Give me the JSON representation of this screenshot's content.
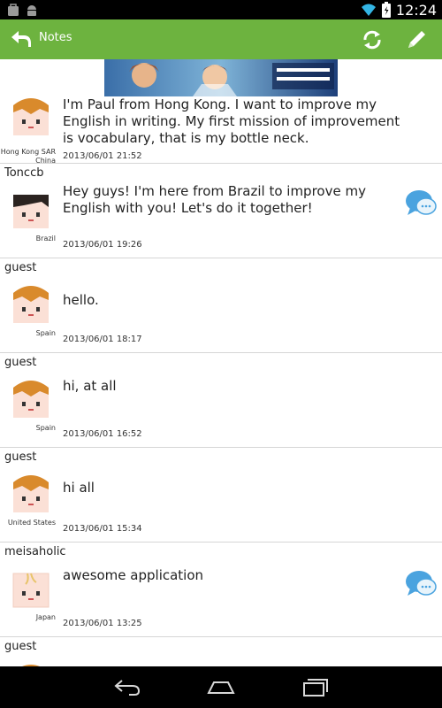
{
  "statusbar": {
    "time": "12:24"
  },
  "actionbar": {
    "title": "Notes"
  },
  "notes": [
    {
      "username": "",
      "country_line1": "Hong Kong SAR",
      "country_line2": "China",
      "message": "I'm Paul from Hong Kong. I want to improve my English in writing. My first mission of improvement is vocabulary, that is my bottle neck.",
      "timestamp": "2013/06/01 21:52",
      "avatar": "bread-icon"
    },
    {
      "username": "Tonccb",
      "country_line1": "Brazil",
      "country_line2": "",
      "message": "Hey guys! I'm here from Brazil to improve my English with you! Let's do it together!",
      "timestamp": "2013/06/01 19:26",
      "avatar": "toast-hair-icon",
      "has_chat": true
    },
    {
      "username": "guest",
      "country_line1": "Spain",
      "country_line2": "",
      "message": "hello.",
      "timestamp": "2013/06/01 18:17",
      "avatar": "bread-icon"
    },
    {
      "username": "guest",
      "country_line1": "Spain",
      "country_line2": "",
      "message": "hi, at all",
      "timestamp": "2013/06/01 16:52",
      "avatar": "bread-icon"
    },
    {
      "username": "guest",
      "country_line1": "United States",
      "country_line2": "",
      "message": "hi all",
      "timestamp": "2013/06/01 15:34",
      "avatar": "bread-icon"
    },
    {
      "username": "meisaholic",
      "country_line1": "Japan",
      "country_line2": "",
      "message": "awesome application",
      "timestamp": "2013/06/01 13:25",
      "avatar": "tofu-icon",
      "has_chat": true
    },
    {
      "username": "guest",
      "country_line1": "",
      "country_line2": "",
      "message": "",
      "timestamp": "",
      "avatar": "bread-icon"
    }
  ],
  "colors": {
    "actionbar": "#6db33f",
    "bubble": "#4aa3df"
  }
}
